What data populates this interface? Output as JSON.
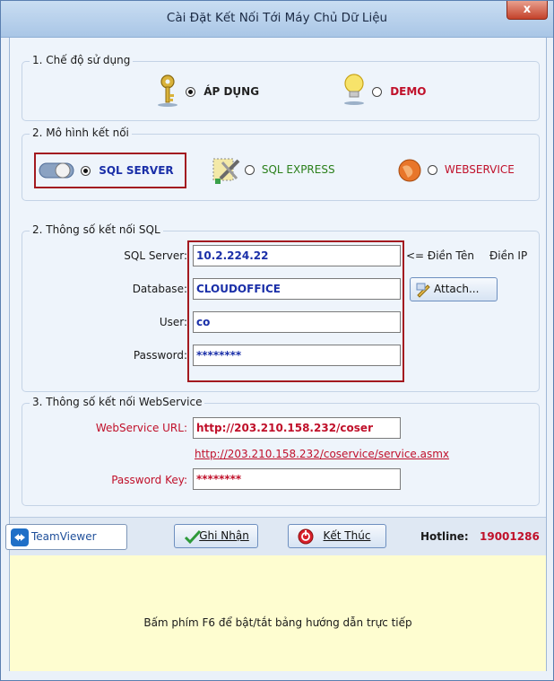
{
  "window": {
    "title": "Cài Đặt Kết Nối Tới Máy Chủ Dữ Liệu",
    "close_label": "x"
  },
  "mode_group": {
    "title": "1. Chế độ sử dụng",
    "apply_label": "ÁP DỤNG",
    "demo_label": "DEMO",
    "selected": "apply"
  },
  "connection_group": {
    "title": "2. Mô hình kết nối",
    "sql_server_label": "SQL SERVER",
    "sql_express_label": "SQL EXPRESS",
    "webservice_label": "WEBSERVICE",
    "selected": "sql_server"
  },
  "sql_group": {
    "title": "2. Thông số kết nối SQL",
    "server_label": "SQL Server:",
    "server_value": "10.2.224.22",
    "hint_arrow": "<= Điền Tên",
    "hint_ip": "Điền IP",
    "database_label": "Database:",
    "database_value": "CLOUDOFFICE",
    "attach_label": "Attach...",
    "user_label": "User:",
    "user_value": "co",
    "password_label": "Password:",
    "password_value": "********"
  },
  "webservice_group": {
    "title": "3. Thông số kết nối WebService",
    "url_label": "WebService URL:",
    "url_value": "http://203.210.158.232/coser",
    "url_link": "http://203.210.158.232/coservice/service.asmx",
    "key_label": "Password Key:",
    "key_value": "********"
  },
  "footer": {
    "teamviewer_label": "TeamViewer",
    "save_label": "Ghi Nhận",
    "exit_label": "Kết Thúc",
    "hotline_label": "Hotline:",
    "hotline_value": "19001286"
  },
  "help": {
    "text": "Bấm phím F6 để bật/tắt bảng hướng dẫn trực tiếp"
  },
  "colors": {
    "accent_red": "#c0102a",
    "value_blue": "#1a2fa8",
    "highlight_border": "#a3191f"
  }
}
